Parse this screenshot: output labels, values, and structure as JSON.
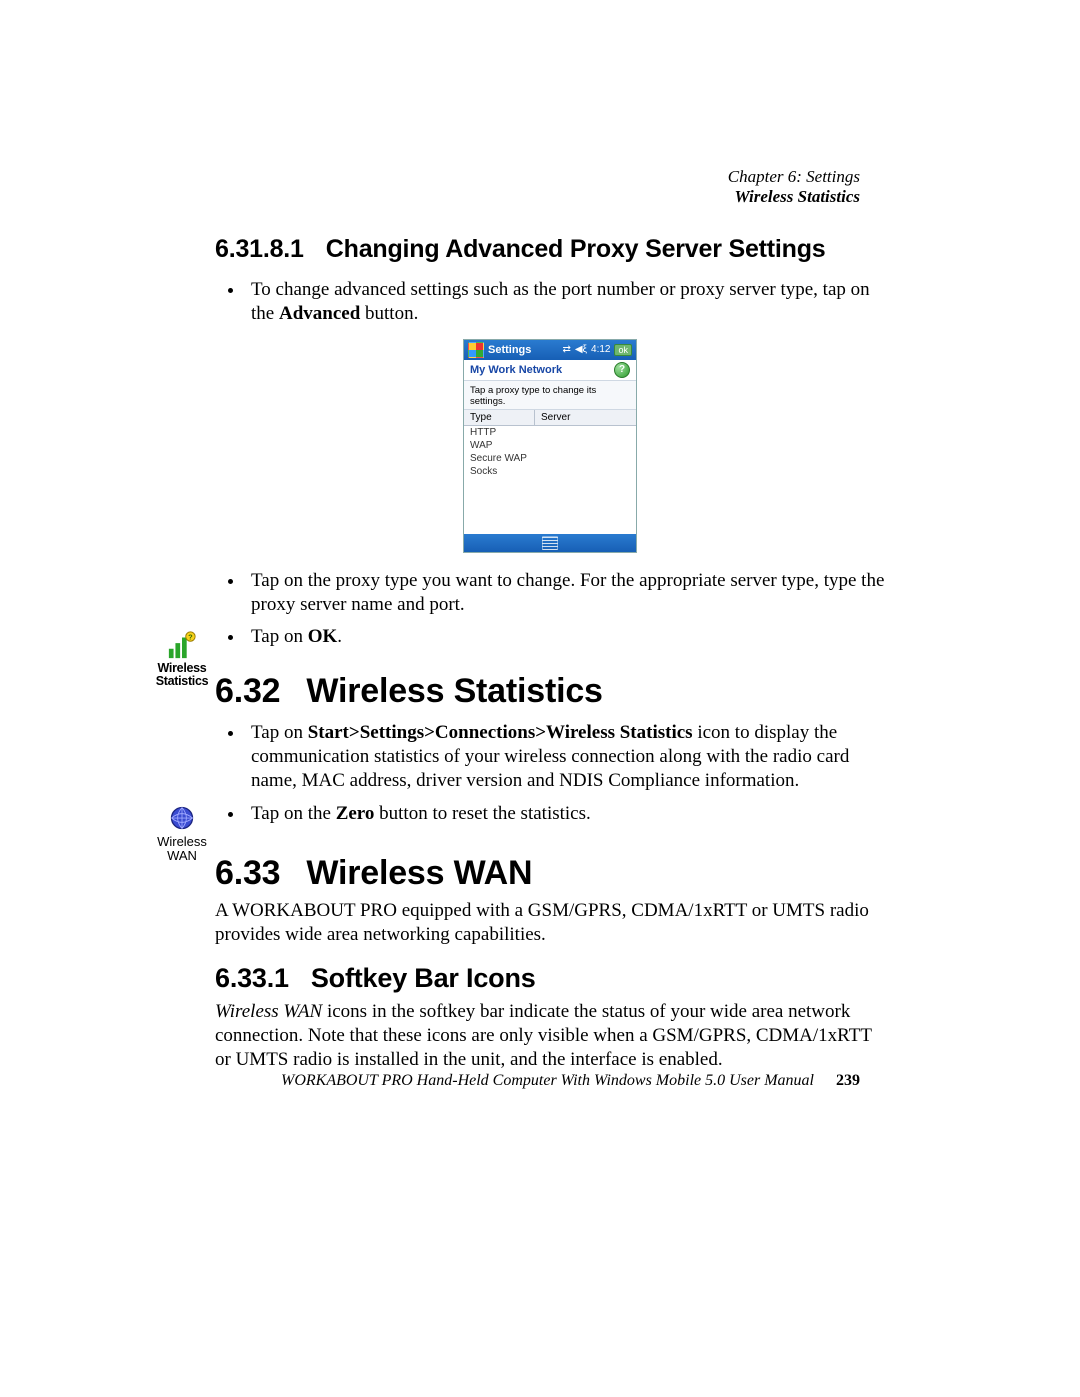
{
  "header": {
    "chapter": "Chapter 6: Settings",
    "section": "Wireless Statistics"
  },
  "sections": {
    "s6_31_8_1": {
      "num": "6.31.8.1",
      "title": "Changing Advanced Proxy Server Settings"
    },
    "s6_32": {
      "num": "6.32",
      "title": "Wireless Statistics"
    },
    "s6_33": {
      "num": "6.33",
      "title": "Wireless WAN"
    },
    "s6_33_1": {
      "num": "6.33.1",
      "title": "Softkey Bar Icons"
    }
  },
  "margin_icons": {
    "wireless_stats": "Wireless Statistics",
    "wireless_wan_l1": "Wireless",
    "wireless_wan_l2": "WAN"
  },
  "bullets": {
    "b1_pre": "To change advanced settings such as the port number or proxy server type, tap on the ",
    "b1_bold": "Advanced",
    "b1_post": " button.",
    "b2": "Tap on the proxy type you want to change. For the appropriate server type, type the proxy server name and port.",
    "b3_pre": "Tap on ",
    "b3_bold": "OK",
    "b3_post": ".",
    "ws1_pre": "Tap on ",
    "ws1_bold": "Start>Settings>Connections>Wireless Statistics",
    "ws1_post": " icon to display the communication statistics of your wireless connection along with the radio card name, MAC address, driver version and NDIS Compliance information.",
    "ws2_pre": "Tap on the ",
    "ws2_bold": "Zero",
    "ws2_post": " button to reset the statistics."
  },
  "paras": {
    "wan_intro": "A WORKABOUT PRO equipped with a GSM/GPRS, CDMA/1xRTT or UMTS radio provides wide area networking capabilities.",
    "softkey_para_em": "Wireless WAN",
    "softkey_para_rest": " icons in the softkey bar indicate the status of your wide area network connection. Note that these icons are only visible when a GSM/GPRS, CDMA/1xRTT or UMTS radio is installed in the unit, and the interface is enabled."
  },
  "screenshot": {
    "title": "Settings",
    "time": "4:12",
    "ok": "ok",
    "subtitle": "My Work Network",
    "instruction": "Tap a proxy type to change its settings.",
    "col_type": "Type",
    "col_server": "Server",
    "rows": [
      "HTTP",
      "WAP",
      "Secure WAP",
      "Socks"
    ]
  },
  "footer": {
    "text": "WORKABOUT PRO Hand-Held Computer With Windows Mobile 5.0 User Manual",
    "page": "239"
  }
}
